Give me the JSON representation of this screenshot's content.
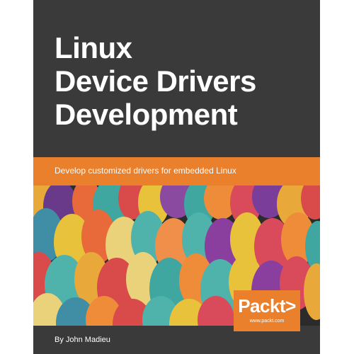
{
  "cover": {
    "title_lines": [
      "Linux",
      "Device Drivers",
      "Development"
    ],
    "subtitle": "Develop customized drivers for embedded Linux",
    "author": "By John Madieu",
    "publisher": {
      "logo_text": "Packt>",
      "url": "www.packt.com"
    },
    "colors": {
      "background": "#3a3a3a",
      "accent": "#ea7f2c",
      "text": "#ffffff"
    }
  }
}
